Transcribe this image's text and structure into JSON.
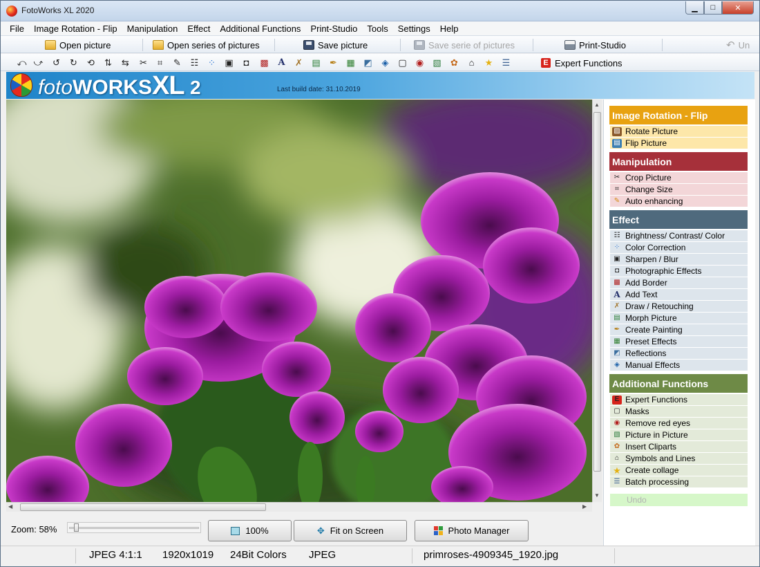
{
  "window": {
    "title": "FotoWorks XL 2020"
  },
  "menu": [
    "File",
    "Image Rotation - Flip",
    "Manipulation",
    "Effect",
    "Additional Functions",
    "Print-Studio",
    "Tools",
    "Settings",
    "Help"
  ],
  "toolbar": {
    "open_picture": "Open picture",
    "open_series": "Open series of pictures",
    "save_picture": "Save picture",
    "save_serie": "Save serie of pictures",
    "print_studio": "Print-Studio",
    "undo": "Un",
    "expert_functions": "Expert Functions"
  },
  "banner": {
    "logo_foto": "foto",
    "logo_works": "WORKS",
    "logo_xl": "XL",
    "logo_num": "2",
    "build_date": "Last build date: 31.10.2019"
  },
  "zoom": {
    "label": "Zoom: 58%",
    "value_percent": 58
  },
  "buttons": {
    "zoom_100": "100%",
    "fit_on_screen": "Fit on Screen",
    "photo_manager": "Photo Manager"
  },
  "status": {
    "format": "JPEG  4:1:1",
    "resolution": "1920x1019",
    "colors": "24Bit Colors",
    "type": "JPEG",
    "filename": "primroses-4909345_1920.jpg"
  },
  "panel": {
    "sections": [
      {
        "title": "Image Rotation - Flip",
        "head_color": "#e8a211",
        "item_color": "#fde7a9",
        "items": [
          {
            "label": "Rotate Picture",
            "icon": "rotate-picture-icon"
          },
          {
            "label": "Flip Picture",
            "icon": "flip-picture-icon"
          }
        ]
      },
      {
        "title": "Manipulation",
        "head_color": "#a6303a",
        "item_color": "#f3d6d8",
        "items": [
          {
            "label": "Crop Picture",
            "icon": "crop-icon"
          },
          {
            "label": "Change Size",
            "icon": "resize-icon"
          },
          {
            "label": "Auto enhancing",
            "icon": "auto-enhance-icon"
          }
        ]
      },
      {
        "title": "Effect",
        "head_color": "#4f6a7d",
        "item_color": "#dde5ec",
        "items": [
          {
            "label": "Brightness/ Contrast/ Color",
            "icon": "brightness-icon"
          },
          {
            "label": "Color Correction",
            "icon": "color-correction-icon"
          },
          {
            "label": "Sharpen / Blur",
            "icon": "sharpen-icon"
          },
          {
            "label": "Photographic Effects",
            "icon": "camera-icon"
          },
          {
            "label": "Add Border",
            "icon": "border-icon"
          },
          {
            "label": "Add Text",
            "icon": "text-icon"
          },
          {
            "label": "Draw / Retouching",
            "icon": "draw-icon"
          },
          {
            "label": "Morph Picture",
            "icon": "morph-icon"
          },
          {
            "label": "Create Painting",
            "icon": "painting-icon"
          },
          {
            "label": "Preset Effects",
            "icon": "preset-effects-icon"
          },
          {
            "label": "Reflections",
            "icon": "reflections-icon"
          },
          {
            "label": "Manual Effects",
            "icon": "manual-effects-icon"
          }
        ]
      },
      {
        "title": "Additional Functions",
        "head_color": "#6e8a46",
        "item_color": "#e3ead9",
        "items": [
          {
            "label": "Expert Functions",
            "icon": "expert-functions-icon"
          },
          {
            "label": "Masks",
            "icon": "masks-icon"
          },
          {
            "label": "Remove red eyes",
            "icon": "red-eye-icon"
          },
          {
            "label": "Picture in Picture",
            "icon": "picture-in-picture-icon"
          },
          {
            "label": "Insert Cliparts",
            "icon": "clipart-icon"
          },
          {
            "label": "Symbols and Lines",
            "icon": "symbols-icon"
          },
          {
            "label": "Create collage",
            "icon": "collage-star-icon"
          },
          {
            "label": "Batch processing",
            "icon": "batch-icon"
          }
        ]
      }
    ],
    "undo": "Undo"
  }
}
